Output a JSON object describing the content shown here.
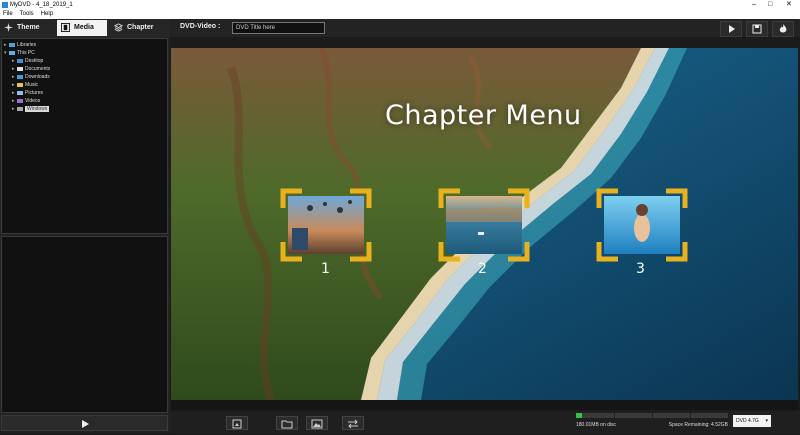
{
  "window": {
    "title": "MyDVD - 4_18_2019_1"
  },
  "menu": [
    "File",
    "Tools",
    "Help"
  ],
  "tabs": [
    {
      "label": "Theme",
      "icon": "theme-icon",
      "active": false
    },
    {
      "label": "Media",
      "icon": "media-film-icon",
      "active": true
    },
    {
      "label": "Chapter",
      "icon": "layers-icon",
      "active": false
    }
  ],
  "tree": [
    {
      "label": "Libraries",
      "level": 0,
      "expanded": true
    },
    {
      "label": "This PC",
      "level": 0,
      "expanded": true
    },
    {
      "label": "Desktop",
      "level": 1
    },
    {
      "label": "Documents",
      "level": 1
    },
    {
      "label": "Downloads",
      "level": 1
    },
    {
      "label": "Music",
      "level": 1
    },
    {
      "label": "Pictures",
      "level": 1
    },
    {
      "label": "Videos",
      "level": 1
    },
    {
      "label": "Windows",
      "level": 1,
      "selected": true
    }
  ],
  "header": {
    "label": "DVD-Video :",
    "title_value": "DVD Title here"
  },
  "header_buttons": [
    "play-icon",
    "save-icon",
    "burn-icon"
  ],
  "menu_preview": {
    "title": "Chapter Menu",
    "accent": "#e8b21f",
    "chapters": [
      {
        "number": "1",
        "scene": "balloons"
      },
      {
        "number": "2",
        "scene": "lake"
      },
      {
        "number": "3",
        "scene": "underwater"
      }
    ]
  },
  "bottom_buttons": [
    "add-media-icon",
    "open-folder-icon",
    "image-icon",
    "swap-icon"
  ],
  "disc": {
    "used_text": "180.01MB on disc",
    "remaining_text": "Space Remaining: 4.52GB",
    "used_fraction": 0.04,
    "type_value": "DVD 4.7G"
  }
}
